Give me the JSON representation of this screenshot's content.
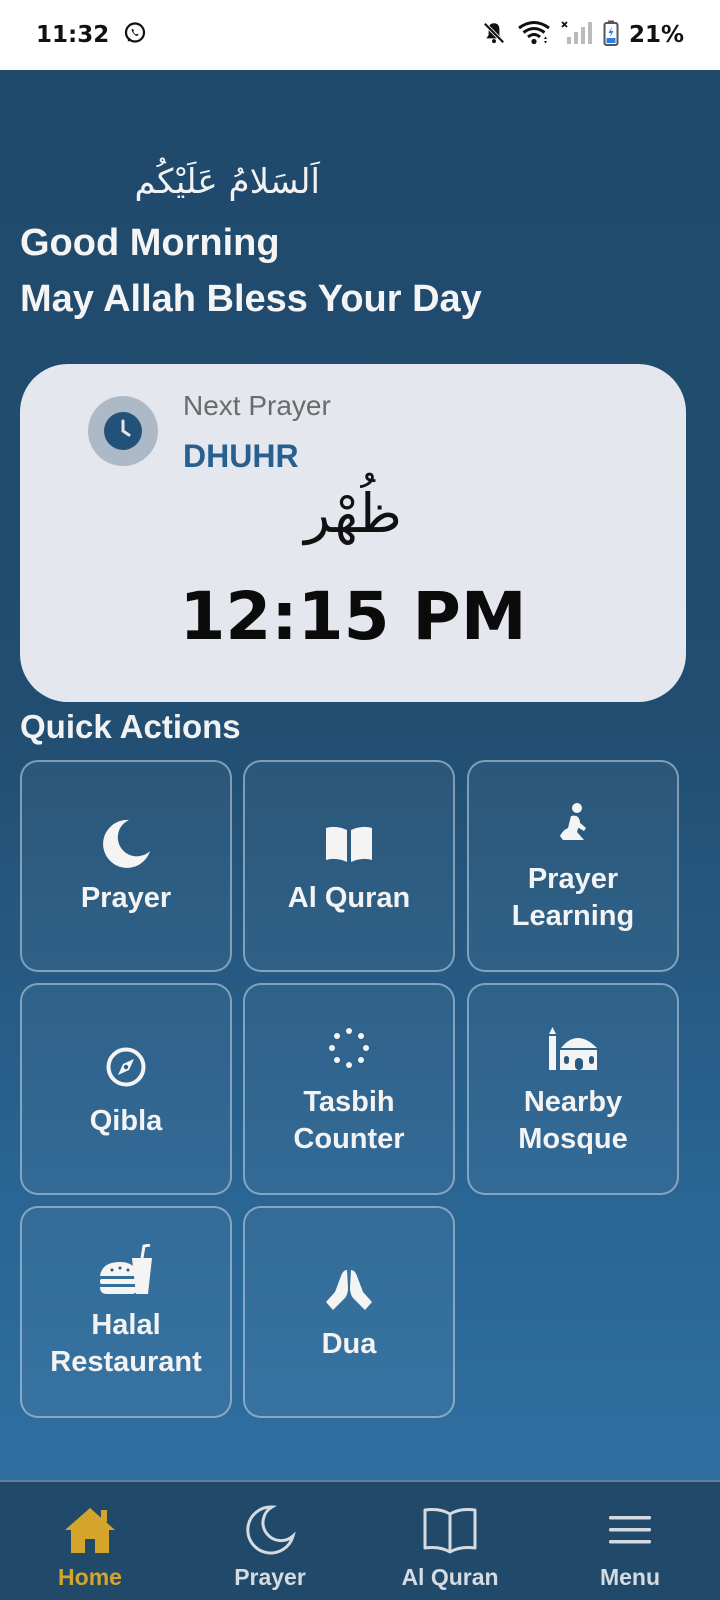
{
  "status_bar": {
    "time": "11:32",
    "battery": "21%",
    "icons": [
      "whatsapp-icon",
      "mute-icon",
      "wifi-icon",
      "signal-icon",
      "battery-icon"
    ]
  },
  "greeting": {
    "arabic": "اَلسَلامُ عَلَيْكُم",
    "line1": "Good Morning",
    "line2": "May Allah Bless Your Day"
  },
  "next_prayer": {
    "label": "Next Prayer",
    "name": "DHUHR",
    "arabic": "ظُهْر",
    "time": "12:15 PM",
    "icon": "clock-icon"
  },
  "quick_actions": {
    "title": "Quick Actions",
    "items": [
      {
        "label": "Prayer",
        "icon": "moon-icon"
      },
      {
        "label": "Al Quran",
        "icon": "book-icon"
      },
      {
        "label": "Prayer Learning",
        "icon": "praying-person-icon"
      },
      {
        "label": "Qibla",
        "icon": "compass-icon"
      },
      {
        "label": "Tasbih Counter",
        "icon": "beads-icon"
      },
      {
        "label": "Nearby Mosque",
        "icon": "mosque-icon"
      },
      {
        "label": "Halal Restaurant",
        "icon": "food-icon"
      },
      {
        "label": "Dua",
        "icon": "praying-hands-icon"
      }
    ]
  },
  "bottom_nav": {
    "items": [
      {
        "label": "Home",
        "icon": "home-icon",
        "active": true
      },
      {
        "label": "Prayer",
        "icon": "moon-icon"
      },
      {
        "label": "Al Quran",
        "icon": "book-icon"
      },
      {
        "label": "Menu",
        "icon": "menu-icon"
      }
    ]
  },
  "colors": {
    "background_top": "#1f4a6c",
    "background_bottom": "#2f6fa0",
    "card": "#e4e7ee",
    "prayer_name": "#27608f",
    "nav_active": "#d5a52b"
  }
}
